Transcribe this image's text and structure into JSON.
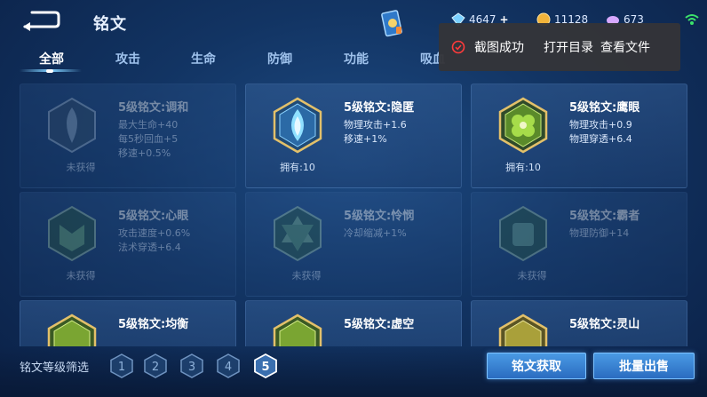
{
  "header": {
    "title": "铭文",
    "currencies": [
      {
        "icon": "diamond-icon",
        "value": "4647",
        "color": "#7ad0ff"
      },
      {
        "icon": "gold-coin-icon",
        "value": "11128",
        "color": "#f2b43a"
      },
      {
        "icon": "crystal-icon",
        "value": "673",
        "color": "#d7a8ff"
      }
    ]
  },
  "tabs": [
    {
      "label": "全部",
      "active": true
    },
    {
      "label": "攻击"
    },
    {
      "label": "生命"
    },
    {
      "label": "防御"
    },
    {
      "label": "功能"
    },
    {
      "label": "吸血"
    }
  ],
  "toast": {
    "message": "截图成功",
    "action_open_folder": "打开目录",
    "action_view_file": "查看文件"
  },
  "cards": [
    {
      "name": "5级铭文:调和",
      "stats": [
        "最大生命+40",
        "每5秒回血+5",
        "移速+0.5%"
      ],
      "status": "未获得",
      "owned": false,
      "color": "#8fa9c4"
    },
    {
      "name": "5级铭文:隐匿",
      "stats": [
        "物理攻击+1.6",
        "移速+1%"
      ],
      "status": "拥有:10",
      "owned": true,
      "color": "#4aa8e6"
    },
    {
      "name": "5级铭文:鹰眼",
      "stats": [
        "物理攻击+0.9",
        "物理穿透+6.4"
      ],
      "status": "拥有:10",
      "owned": true,
      "color": "#7ec23a"
    },
    {
      "name": "5级铭文:心眼",
      "stats": [
        "攻击速度+0.6%",
        "法术穿透+6.4"
      ],
      "status": "未获得",
      "owned": false,
      "color": "#6fb07a"
    },
    {
      "name": "5级铭文:怜悯",
      "stats": [
        "冷却缩减+1%"
      ],
      "status": "未获得",
      "owned": false,
      "color": "#7fb48a"
    },
    {
      "name": "5级铭文:霸者",
      "stats": [
        "物理防御+14"
      ],
      "status": "未获得",
      "owned": false,
      "color": "#6fa88c"
    },
    {
      "name": "5级铭文:均衡",
      "stats": [],
      "status": "",
      "owned": true,
      "color": "#9bc442"
    },
    {
      "name": "5级铭文:虚空",
      "stats": [],
      "status": "",
      "owned": true,
      "color": "#9bc442"
    },
    {
      "name": "5级铭文:灵山",
      "stats": [],
      "status": "",
      "owned": true,
      "color": "#c9c14a"
    }
  ],
  "footer": {
    "filter_label": "铭文等级筛选",
    "levels": [
      "1",
      "2",
      "3",
      "4",
      "5"
    ],
    "selected_level": "5",
    "get_button": "铭文获取",
    "sell_button": "批量出售"
  }
}
